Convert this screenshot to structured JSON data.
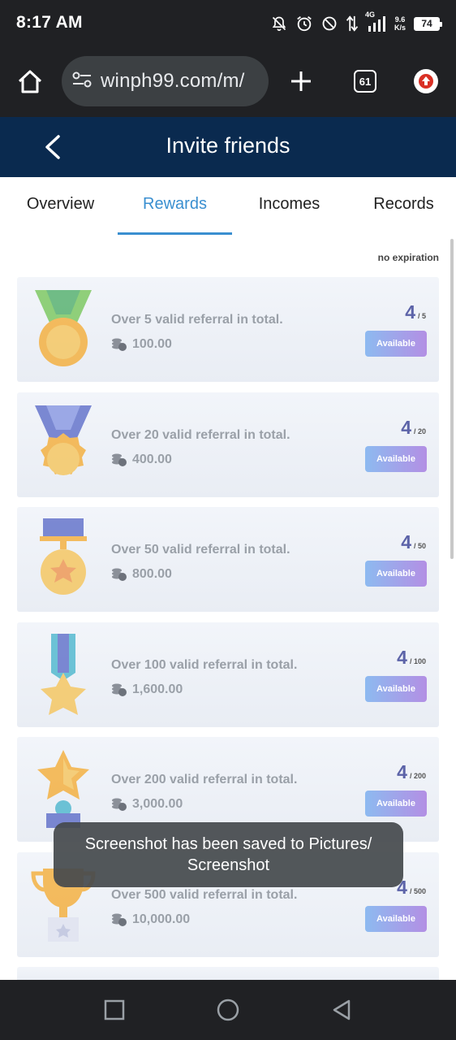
{
  "status_bar": {
    "time": "8:17 AM",
    "network_type": "4G",
    "net_speed_value": "9.6",
    "net_speed_unit": "K/s",
    "battery": "74"
  },
  "browser": {
    "url": "winph99.com/m/",
    "tab_count": "61"
  },
  "header": {
    "title": "Invite friends"
  },
  "tabs": [
    {
      "label": "Overview",
      "active": false
    },
    {
      "label": "Rewards",
      "active": true
    },
    {
      "label": "Incomes",
      "active": false
    },
    {
      "label": "Records",
      "active": false
    }
  ],
  "expiration_label": "no expiration",
  "rewards": [
    {
      "icon": "green-ribbon-medal-icon",
      "description": "Over 5 valid referral in total.",
      "amount": "100.00",
      "progress": "4",
      "total": "/ 5",
      "button": "Available"
    },
    {
      "icon": "blue-ribbon-medal-icon",
      "description": "Over 20 valid referral in total.",
      "amount": "400.00",
      "progress": "4",
      "total": "/ 20",
      "button": "Available"
    },
    {
      "icon": "star-medal-icon",
      "description": "Over 50 valid referral in total.",
      "amount": "800.00",
      "progress": "4",
      "total": "/ 50",
      "button": "Available"
    },
    {
      "icon": "star-ribbon-icon",
      "description": "Over 100 valid referral in total.",
      "amount": "1,600.00",
      "progress": "4",
      "total": "/ 100",
      "button": "Available"
    },
    {
      "icon": "star-trophy-icon",
      "description": "Over 200 valid referral in total.",
      "amount": "3,000.00",
      "progress": "4",
      "total": "/ 200",
      "button": "Available"
    },
    {
      "icon": "gold-cup-icon",
      "description": "Over 500 valid referral in total.",
      "amount": "10,000.00",
      "progress": "4",
      "total": "/ 500",
      "button": "Available"
    }
  ],
  "toast": "Screenshot has been saved to  Pictures/ Screenshot",
  "colors": {
    "header_bg": "#0a2a4f",
    "tab_active": "#3a8fd0",
    "progress": "#5c63a8",
    "button_gradient_start": "#8dbaf0",
    "button_gradient_end": "#b38fe4"
  }
}
